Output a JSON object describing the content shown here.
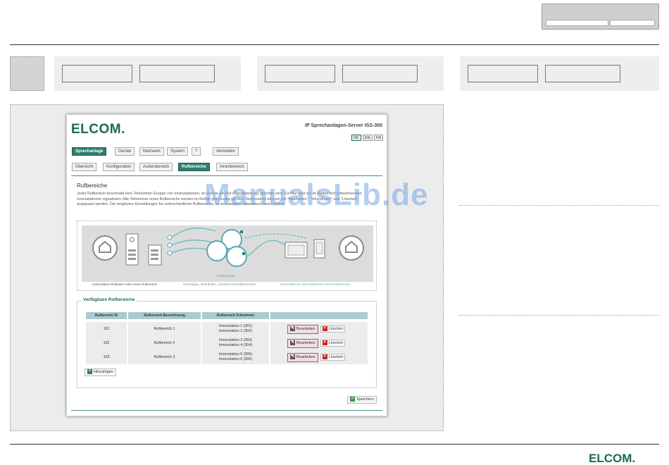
{
  "window": {
    "brand": "ELCOM.",
    "server_title": "IP Sprechanlagen-Server ISS-300",
    "languages": [
      "DE",
      "EN",
      "FR"
    ],
    "main_nav": [
      "Sprechanlage",
      "Geräte",
      "Netzwerk",
      "System",
      "?",
      "Abmelden"
    ],
    "sub_nav": [
      "Übersicht",
      "Konfiguration",
      "Außenbereich",
      "Rufbereiche",
      "Innenbereich"
    ],
    "page_heading": "Rufbereiche",
    "intro_text": "Jeder Rufbereich beschreibt eine Teilnehmer-Gruppe von Innenstationen, an welche ein Ruf (Signalisierung) gerichtet wird. Ein Ruf wird am im Rufbereich teilnehmenden Innenstationen signalisiert. Alle Teilnehmer eines Rufbereichs werden im Ruffall gleichzeitig gerufen. Rufbereiche können mit \"Bearbeiten\", \"Hinzufügen\" und \"Löschen\" angepasst werden. Die möglichen Einstellungen für unterschiedliche Rufbereiche, ist im Installationshandbuch beschrieben.",
    "diagram": {
      "center_label": "Rufbereiche",
      "captions": [
        "Außenstation-Ruftaster rufen einen Rufbereich",
        "Hinzufügen, Bearbeiten, Löschen von Rufbereichen",
        "Innenstationen sind Teilnehmer eines Rufbereichs"
      ]
    },
    "available": {
      "legend": "Verfügbare Rufbereiche",
      "columns": [
        "Rufbereich ID",
        "Rufbereich.Bezeichnung",
        "Rufbereich.Teilnehmer",
        ""
      ],
      "rows": [
        {
          "id": "101",
          "name": "Rufbereich 1",
          "members": [
            "Innenstation 1 (301)",
            "Innenstation 2 (302)"
          ]
        },
        {
          "id": "102",
          "name": "Rufbereich 2",
          "members": [
            "Innenstation 3 (303)",
            "Innenstation 4 (304)"
          ]
        },
        {
          "id": "103",
          "name": "Rufbereich 3",
          "members": [
            "Innenstation 5 (305)",
            "Innenstation 6 (306)"
          ]
        }
      ],
      "edit_label": "Bearbeiten",
      "delete_label": "Löschen",
      "add_label": "Hinzufügen"
    },
    "save_label": "Speichern"
  },
  "watermark": "ManualsLib.de",
  "footer": {
    "brand": "ELCOM."
  },
  "colors": {
    "brand": "#1a6a5a",
    "table_header": "#aacbd0",
    "edit_border": "#b05070"
  }
}
